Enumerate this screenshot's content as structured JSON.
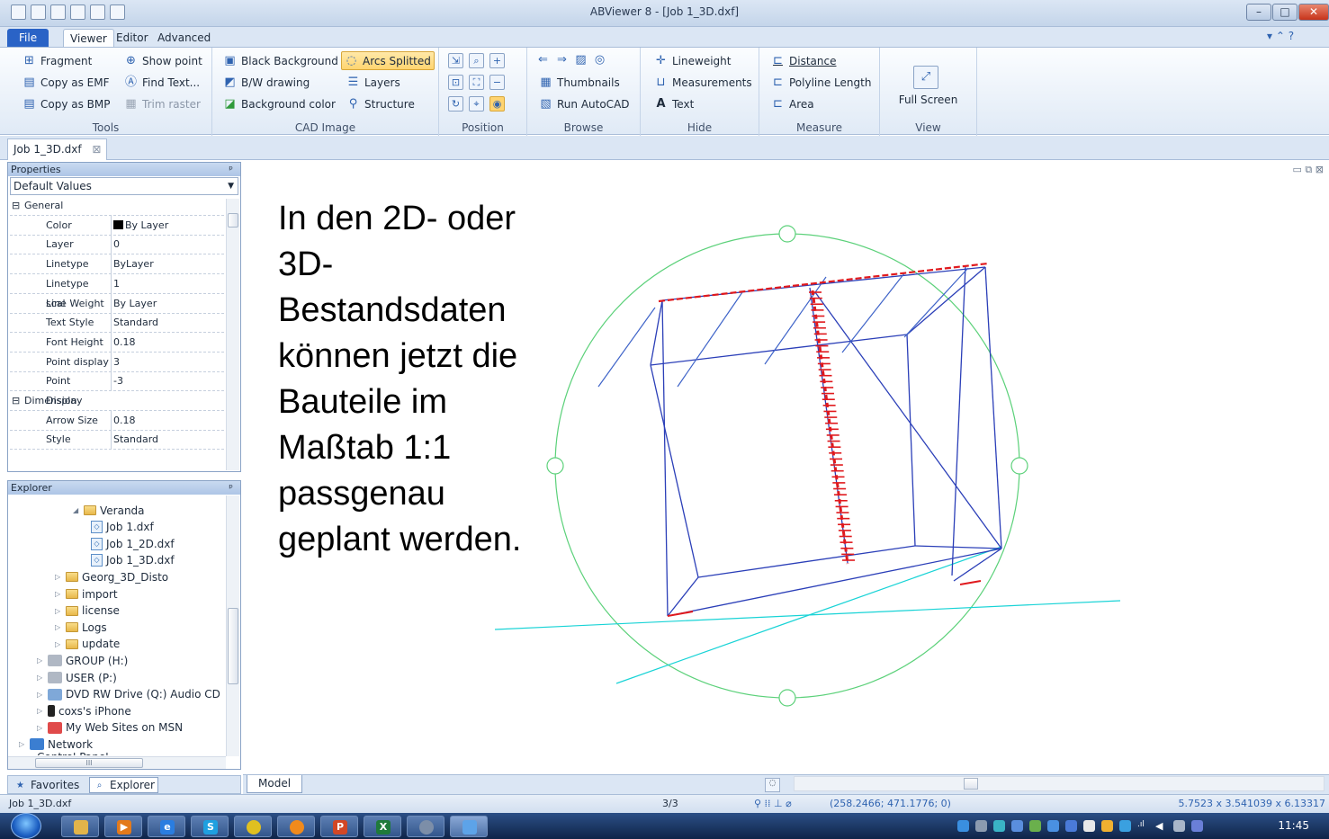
{
  "window": {
    "title": "ABViewer 8 - [Job 1_3D.dxf]"
  },
  "ribbon": {
    "tabs": [
      "File",
      "Viewer",
      "Editor",
      "Advanced"
    ],
    "active_tab": "Viewer",
    "groups": {
      "tools": {
        "label": "Tools",
        "items": [
          "Fragment",
          "Show point",
          "Copy as EMF",
          "Find Text...",
          "Copy as BMP",
          "Trim raster"
        ]
      },
      "cad_image": {
        "label": "CAD Image",
        "items": [
          "Black Background",
          "Arcs Splitted",
          "B/W drawing",
          "Layers",
          "Background color",
          "Structure"
        ]
      },
      "position": {
        "label": "Position"
      },
      "browse": {
        "label": "Browse",
        "items": [
          "Thumbnails",
          "Run AutoCAD"
        ]
      },
      "hide": {
        "label": "Hide",
        "items": [
          "Lineweight",
          "Measurements",
          "Text"
        ]
      },
      "measure": {
        "label": "Measure",
        "items": [
          "Distance",
          "Polyline Length",
          "Area"
        ]
      },
      "view": {
        "label": "View",
        "items": [
          "Full Screen"
        ]
      }
    }
  },
  "document_tab": "Job 1_3D.dxf",
  "properties": {
    "header": "Properties",
    "pin": "ᵖ",
    "combo_value": "Default Values",
    "rows": [
      {
        "key": "General",
        "value": "",
        "category": true
      },
      {
        "key": "Color",
        "value": "By Layer"
      },
      {
        "key": "Layer",
        "value": "0"
      },
      {
        "key": "Linetype",
        "value": "ByLayer"
      },
      {
        "key": "Linetype scal",
        "value": "1"
      },
      {
        "key": "Line Weight",
        "value": "By Layer"
      },
      {
        "key": "Text Style",
        "value": "Standard"
      },
      {
        "key": "Font Height",
        "value": "0.18"
      },
      {
        "key": "Point display",
        "value": "3"
      },
      {
        "key": "Point Display",
        "value": "-3"
      },
      {
        "key": "Dimension",
        "value": "",
        "category": true
      },
      {
        "key": "Arrow Size",
        "value": "0.18"
      },
      {
        "key": "Style",
        "value": "Standard"
      }
    ]
  },
  "explorer": {
    "header": "Explorer",
    "items": [
      {
        "label": "Veranda",
        "type": "folder-open",
        "indent": 3
      },
      {
        "label": "Job 1.dxf",
        "type": "file",
        "indent": 4
      },
      {
        "label": "Job 1_2D.dxf",
        "type": "file",
        "indent": 4
      },
      {
        "label": "Job 1_3D.dxf",
        "type": "file",
        "indent": 4
      },
      {
        "label": "Georg_3D_Disto",
        "type": "folder",
        "indent": 2
      },
      {
        "label": "import",
        "type": "folder",
        "indent": 2
      },
      {
        "label": "license",
        "type": "folder",
        "indent": 2
      },
      {
        "label": "Logs",
        "type": "folder",
        "indent": 2
      },
      {
        "label": "update",
        "type": "folder",
        "indent": 2
      },
      {
        "label": "GROUP (H:)",
        "type": "drive",
        "indent": 1
      },
      {
        "label": "USER (P:)",
        "type": "drive",
        "indent": 1
      },
      {
        "label": "DVD RW Drive (Q:) Audio CD",
        "type": "dvd",
        "indent": 1
      },
      {
        "label": "coxs's iPhone",
        "type": "phone",
        "indent": 1
      },
      {
        "label": "My Web Sites on MSN",
        "type": "web",
        "indent": 1
      },
      {
        "label": "Network",
        "type": "network",
        "indent": 0
      }
    ],
    "cut_off_item": "Control Panel",
    "hscroll_grip": "III"
  },
  "bottom_tabs": [
    "Favorites",
    "Explorer"
  ],
  "canvas": {
    "overlay_text": "In den 2D- oder 3D-Bestandsdaten können jetzt die Bauteile im Maßtab 1:1 passgenau geplant werden.",
    "layout_tab": "Model"
  },
  "status": {
    "file": "Job 1_3D.dxf",
    "page": "3/3",
    "coords": "(258.2466; 471.1776; 0)",
    "dimensions": "5.7523 x 3.541039 x 6.13317"
  },
  "taskbar": {
    "clock": "11:45"
  },
  "colors": {
    "circle": "#5cd17a",
    "box": "#2b3fb8",
    "cyan": "#18d3d6",
    "marker": "#e0191d"
  }
}
